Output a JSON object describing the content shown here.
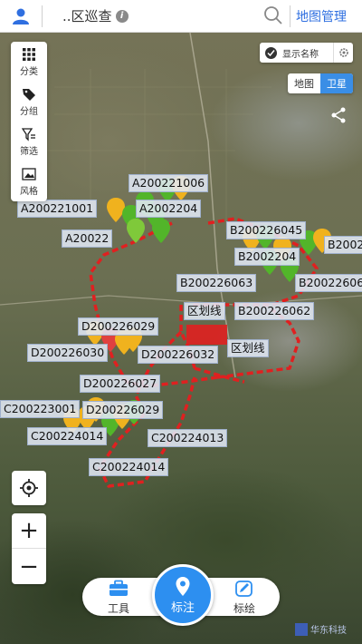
{
  "header": {
    "title": "..区巡查",
    "manage_label": "地图管理"
  },
  "toolbar": [
    {
      "label": "分类",
      "icon": "grid-icon"
    },
    {
      "label": "分组",
      "icon": "tag-icon"
    },
    {
      "label": "筛选",
      "icon": "filter-icon"
    },
    {
      "label": "风格",
      "icon": "image-icon"
    }
  ],
  "layer_toggle": {
    "label": "显示名称"
  },
  "map_type": {
    "options": [
      "地图",
      "卫星"
    ],
    "selected": "卫星"
  },
  "map_labels": [
    "A200221006",
    "A200221001",
    "A2002204",
    "A20022",
    "B200226045",
    "B2002",
    "B2002204",
    "B200226063",
    "B20022606",
    "B200226062",
    "区划线",
    "D200226029",
    "D200226030",
    "D200226032",
    "区划线",
    "D200226027",
    "C200223001",
    "D200226029",
    "C200224014",
    "C200224013",
    "C200224014"
  ],
  "bottom_bar": {
    "tool_label": "工具",
    "mark_label": "标注",
    "draw_label": "标绘"
  },
  "logo_text": "华东科技",
  "colors": {
    "accent": "#2d8ff0",
    "boundary": "#e02020",
    "marker_green": "#52b52a",
    "marker_yellow": "#f0b21e"
  }
}
